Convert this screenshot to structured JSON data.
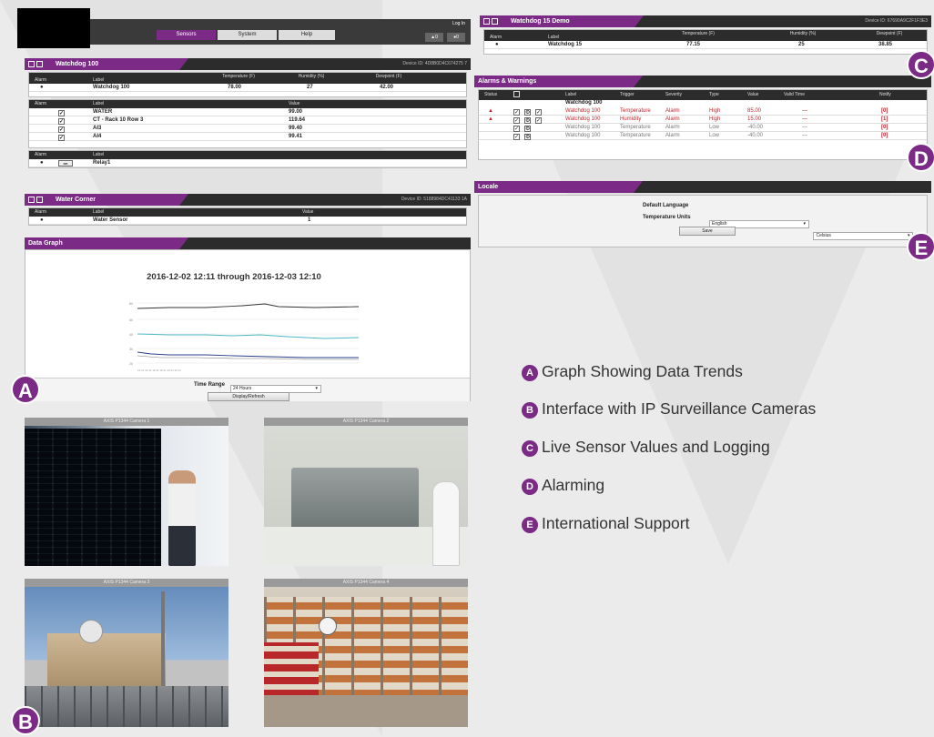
{
  "nav": {
    "tabs": [
      "Sensors",
      "System",
      "Help"
    ],
    "login": "Log In",
    "status_alarms": "▲0",
    "status_warnings": "●0"
  },
  "wd100": {
    "title": "Watchdog 100",
    "device": "Device ID: 4D8B0D4C674275 7",
    "headers": [
      "Alarm",
      "Label",
      "Temperature (F)",
      "Humidity (%)",
      "Dewpoint (F)"
    ],
    "row": {
      "alarm": "●",
      "label": "Watchdog 100",
      "temp": "78.00",
      "hum": "27",
      "dew": "42.00"
    },
    "sub_headers": [
      "Alarm",
      "Label",
      "Value"
    ],
    "sub_rows": [
      {
        "label": "WATER",
        "value": "99.00"
      },
      {
        "label": "CT - Rack 10 Row 3",
        "value": "119.64"
      },
      {
        "label": "AI3",
        "value": "99.40"
      },
      {
        "label": "AI4",
        "value": "99.41"
      }
    ],
    "relay_headers": [
      "Alarm",
      "Label"
    ],
    "relay": {
      "alarm": "●",
      "switch": "on",
      "label": "Relay1"
    }
  },
  "water": {
    "title": "Water Corner",
    "device": "Device ID: 5188984DC41133 1A",
    "headers": [
      "Alarm",
      "Label",
      "Value"
    ],
    "row": {
      "alarm": "●",
      "label": "Water Sensor",
      "value": "1"
    }
  },
  "graph": {
    "title": "Data Graph",
    "chart_title": "2016-12-02 12:11 through 2016-12-03 12:10",
    "time_range_label": "Time Range",
    "time_range_value": "24 Hours",
    "button": "Display/Refresh"
  },
  "wd15": {
    "title": "Watchdog 15 Demo",
    "device": "Device ID: 67690A9C2F1F3E3",
    "headers": [
      "Alarm",
      "Label",
      "Temperature (F)",
      "Humidity (%)",
      "Dewpoint (F)"
    ],
    "row": {
      "alarm": "●",
      "label": "Watchdog 15",
      "temp": "77.15",
      "hum": "25",
      "dew": "38.85"
    }
  },
  "alarms": {
    "title": "Alarms & Warnings",
    "headers": [
      "Status",
      "",
      "Label",
      "Trigger",
      "Severity",
      "Type",
      "Value",
      "Valid Time",
      "Notify"
    ],
    "group": "Watchdog 100",
    "rows": [
      {
        "status": "▲",
        "label": "Watchdog 100",
        "trigger": "Temperature",
        "severity": "Alarm",
        "type": "High",
        "value": "85.00",
        "valid": "—",
        "notify": "[0]",
        "active": true
      },
      {
        "status": "▲",
        "label": "Watchdog 100",
        "trigger": "Humidity",
        "severity": "Alarm",
        "type": "High",
        "value": "15.00",
        "valid": "—",
        "notify": "[1]",
        "active": true
      },
      {
        "status": "",
        "label": "Watchdog 100",
        "trigger": "Temperature",
        "severity": "Alarm",
        "type": "Low",
        "value": "-40.00",
        "valid": "—",
        "notify": "[0]",
        "active": false
      },
      {
        "status": "",
        "label": "Watchdog 100",
        "trigger": "Temperature",
        "severity": "Alarm",
        "type": "Low",
        "value": "-40.00",
        "valid": "—",
        "notify": "[0]",
        "active": false
      }
    ]
  },
  "locale": {
    "title": "Locale",
    "lang_label": "Default Language",
    "lang_value": "English",
    "units_label": "Temperature Units",
    "units_value": "Celsius",
    "save": "Save"
  },
  "cameras": [
    "AXIS P1344 Camera 1",
    "AXIS P1344 Camera 2",
    "AXIS P1344 Camera 3",
    "AXIS P1344 Camera 4"
  ],
  "badges": {
    "a": "A",
    "b": "B",
    "c": "C",
    "d": "D",
    "e": "E"
  },
  "legend": [
    {
      "letter": "A",
      "text": "Graph Showing Data Trends"
    },
    {
      "letter": "B",
      "text": "Interface with IP Surveillance Cameras"
    },
    {
      "letter": "C",
      "text": "Live Sensor Values and Logging"
    },
    {
      "letter": "D",
      "text": "Alarming"
    },
    {
      "letter": "E",
      "text": "International Support"
    }
  ],
  "colors": {
    "accent": "#7b2b86",
    "alarm": "#c0262d"
  }
}
